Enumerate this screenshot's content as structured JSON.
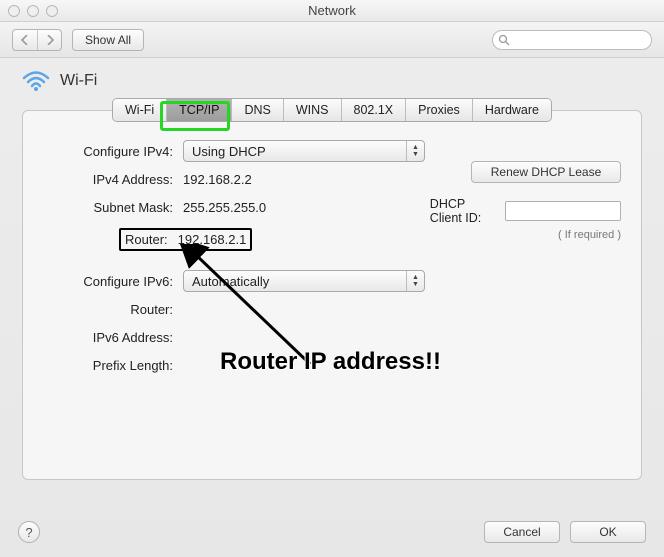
{
  "window": {
    "title": "Network"
  },
  "toolbar": {
    "show_all": "Show All"
  },
  "header": {
    "interface": "Wi-Fi"
  },
  "tabs": {
    "wifi": "Wi-Fi",
    "tcpip": "TCP/IP",
    "dns": "DNS",
    "wins": "WINS",
    "8021x": "802.1X",
    "proxies": "Proxies",
    "hardware": "Hardware",
    "selected": "TCP/IP"
  },
  "fields": {
    "configure_ipv4_label": "Configure IPv4:",
    "configure_ipv4_value": "Using DHCP",
    "ipv4_address_label": "IPv4 Address:",
    "ipv4_address_value": "192.168.2.2",
    "subnet_mask_label": "Subnet Mask:",
    "subnet_mask_value": "255.255.255.0",
    "router_label": "Router:",
    "router_value": "192.168.2.1",
    "configure_ipv6_label": "Configure IPv6:",
    "configure_ipv6_value": "Automatically",
    "router6_label": "Router:",
    "router6_value": "",
    "ipv6_address_label": "IPv6 Address:",
    "ipv6_address_value": "",
    "prefix_length_label": "Prefix Length:",
    "prefix_length_value": ""
  },
  "right": {
    "renew_lease": "Renew DHCP Lease",
    "dhcp_client_id_label": "DHCP Client ID:",
    "dhcp_client_id_value": "",
    "if_required": "( If required )"
  },
  "buttons": {
    "cancel": "Cancel",
    "ok": "OK",
    "help": "?"
  },
  "annotation": {
    "text": "Router IP address!!"
  }
}
